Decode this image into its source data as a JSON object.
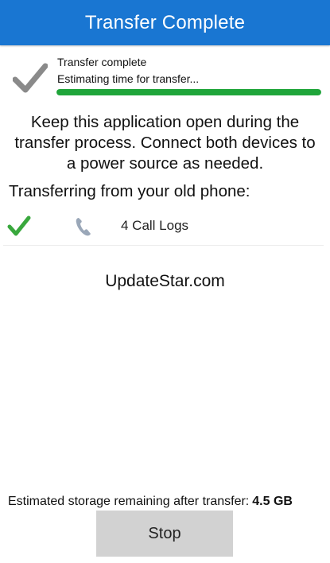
{
  "header": {
    "title": "Transfer Complete",
    "background_color": "#1976d2"
  },
  "status": {
    "line1": "Transfer complete",
    "line2": "Estimating time for transfer...",
    "icon": "check-icon",
    "icon_color": "#8a8a8a",
    "progress_percent": 100,
    "progress_color": "#1fa53a"
  },
  "instructions": "Keep this application open during the transfer process. Connect both devices to a power source as needed.",
  "transfer": {
    "heading": "Transferring from your old phone:",
    "items": [
      {
        "label": "4 Call Logs",
        "status_icon": "check-icon",
        "status_color": "#39a83d",
        "type_icon": "phone-icon",
        "type_color": "#9aa7b8"
      }
    ]
  },
  "watermark": "UpdateStar.com",
  "footer": {
    "storage_label": "Estimated storage remaining after transfer:",
    "storage_value": "4.5 GB",
    "stop_label": "Stop"
  }
}
